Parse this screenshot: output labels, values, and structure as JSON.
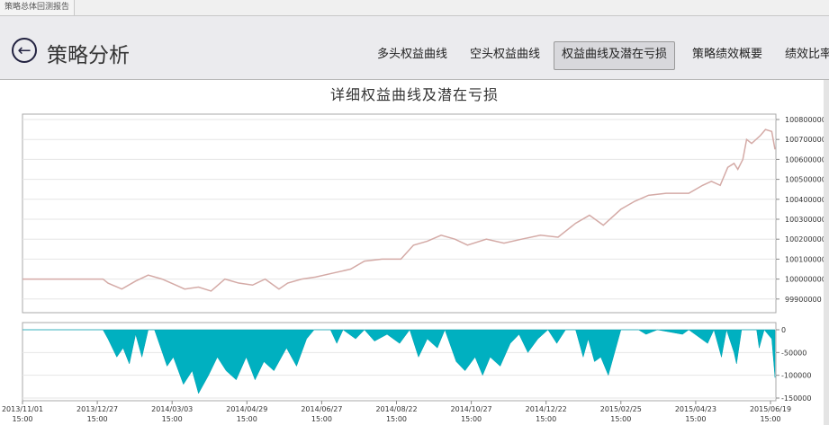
{
  "window_tab": "策略总体回测报告",
  "header": {
    "title": "策略分析",
    "nav": [
      "多头权益曲线",
      "空头权益曲线",
      "权益曲线及潜在亏损",
      "策略绩效概要",
      "绩效比率"
    ],
    "active": 2
  },
  "chart_data": [
    {
      "type": "line",
      "title": "详细权益曲线及潜在亏损",
      "x_unit": "days since 2013-11-01",
      "xlim": [
        0,
        599
      ],
      "ylim": [
        99880000,
        100830000
      ],
      "yticks": [
        "100800000",
        "100700000",
        "100600000",
        "100500000",
        "100400000",
        "100300000",
        "100200000",
        "100100000",
        "100000000",
        "99900000"
      ],
      "line_color": "#d4aaa6",
      "points": [
        [
          0,
          100000000
        ],
        [
          64,
          100000000
        ],
        [
          68,
          99980000
        ],
        [
          79,
          99950000
        ],
        [
          90,
          99990000
        ],
        [
          100,
          100020000
        ],
        [
          111,
          100000000
        ],
        [
          122,
          99970000
        ],
        [
          129,
          99950000
        ],
        [
          140,
          99960000
        ],
        [
          150,
          99940000
        ],
        [
          161,
          100000000
        ],
        [
          172,
          99980000
        ],
        [
          183,
          99970000
        ],
        [
          193,
          100000000
        ],
        [
          204,
          99950000
        ],
        [
          211,
          99980000
        ],
        [
          222,
          100000000
        ],
        [
          233,
          100010000
        ],
        [
          247,
          100030000
        ],
        [
          261,
          100050000
        ],
        [
          272,
          100090000
        ],
        [
          286,
          100100000
        ],
        [
          301,
          100100000
        ],
        [
          311,
          100170000
        ],
        [
          322,
          100190000
        ],
        [
          333,
          100220000
        ],
        [
          344,
          100200000
        ],
        [
          354,
          100170000
        ],
        [
          369,
          100200000
        ],
        [
          383,
          100180000
        ],
        [
          397,
          100200000
        ],
        [
          412,
          100220000
        ],
        [
          426,
          100210000
        ],
        [
          440,
          100280000
        ],
        [
          451,
          100320000
        ],
        [
          462,
          100270000
        ],
        [
          476,
          100350000
        ],
        [
          487,
          100390000
        ],
        [
          498,
          100420000
        ],
        [
          512,
          100430000
        ],
        [
          530,
          100430000
        ],
        [
          541,
          100470000
        ],
        [
          548,
          100490000
        ],
        [
          555,
          100470000
        ],
        [
          561,
          100560000
        ],
        [
          566,
          100580000
        ],
        [
          569,
          100550000
        ],
        [
          573,
          100600000
        ],
        [
          576,
          100700000
        ],
        [
          580,
          100680000
        ],
        [
          587,
          100720000
        ],
        [
          591,
          100750000
        ],
        [
          596,
          100740000
        ],
        [
          599,
          100650000
        ]
      ]
    },
    {
      "type": "area",
      "title": "潜在亏损",
      "xlim": [
        0,
        599
      ],
      "ylim": [
        -155000,
        5000
      ],
      "yticks": [
        "0",
        "-50000",
        "-100000",
        "-150000"
      ],
      "fill_color": "#00b0c0",
      "xticks": [
        "2013/11/01\n15:00",
        "2013/12/27\n15:00",
        "2014/03/03\n15:00",
        "2014/04/29\n15:00",
        "2014/06/27\n15:00",
        "2014/08/22\n15:00",
        "2014/10/27\n15:00",
        "2014/12/22\n15:00",
        "2015/02/25\n15:00",
        "2015/04/23\n15:00",
        "2015/06/19\n15:00"
      ],
      "points": [
        [
          0,
          0
        ],
        [
          64,
          0
        ],
        [
          68,
          -20000
        ],
        [
          75,
          -60000
        ],
        [
          80,
          -40000
        ],
        [
          85,
          -75000
        ],
        [
          90,
          -10000
        ],
        [
          95,
          -60000
        ],
        [
          100,
          0
        ],
        [
          105,
          0
        ],
        [
          110,
          -40000
        ],
        [
          115,
          -80000
        ],
        [
          120,
          -60000
        ],
        [
          128,
          -120000
        ],
        [
          135,
          -90000
        ],
        [
          140,
          -140000
        ],
        [
          148,
          -100000
        ],
        [
          155,
          -60000
        ],
        [
          162,
          -90000
        ],
        [
          170,
          -110000
        ],
        [
          178,
          -60000
        ],
        [
          185,
          -110000
        ],
        [
          192,
          -70000
        ],
        [
          200,
          -90000
        ],
        [
          210,
          -40000
        ],
        [
          218,
          -80000
        ],
        [
          226,
          -20000
        ],
        [
          232,
          0
        ],
        [
          245,
          0
        ],
        [
          250,
          -30000
        ],
        [
          255,
          0
        ],
        [
          265,
          -20000
        ],
        [
          272,
          0
        ],
        [
          280,
          -25000
        ],
        [
          290,
          -10000
        ],
        [
          300,
          -30000
        ],
        [
          308,
          0
        ],
        [
          315,
          -60000
        ],
        [
          322,
          -20000
        ],
        [
          330,
          -40000
        ],
        [
          336,
          0
        ],
        [
          345,
          -70000
        ],
        [
          352,
          -90000
        ],
        [
          360,
          -60000
        ],
        [
          366,
          -100000
        ],
        [
          372,
          -60000
        ],
        [
          380,
          -80000
        ],
        [
          388,
          -30000
        ],
        [
          395,
          -10000
        ],
        [
          402,
          -50000
        ],
        [
          410,
          -20000
        ],
        [
          418,
          0
        ],
        [
          425,
          -30000
        ],
        [
          432,
          0
        ],
        [
          440,
          0
        ],
        [
          446,
          -60000
        ],
        [
          450,
          -20000
        ],
        [
          455,
          -70000
        ],
        [
          460,
          -60000
        ],
        [
          466,
          -100000
        ],
        [
          472,
          -40000
        ],
        [
          476,
          0
        ],
        [
          490,
          0
        ],
        [
          496,
          -10000
        ],
        [
          505,
          0
        ],
        [
          525,
          -10000
        ],
        [
          530,
          0
        ],
        [
          540,
          -20000
        ],
        [
          545,
          -30000
        ],
        [
          550,
          0
        ],
        [
          556,
          -60000
        ],
        [
          560,
          0
        ],
        [
          566,
          -50000
        ],
        [
          568,
          -75000
        ],
        [
          572,
          0
        ],
        [
          584,
          0
        ],
        [
          586,
          -40000
        ],
        [
          590,
          0
        ],
        [
          596,
          -20000
        ],
        [
          599,
          -105000
        ]
      ]
    }
  ]
}
